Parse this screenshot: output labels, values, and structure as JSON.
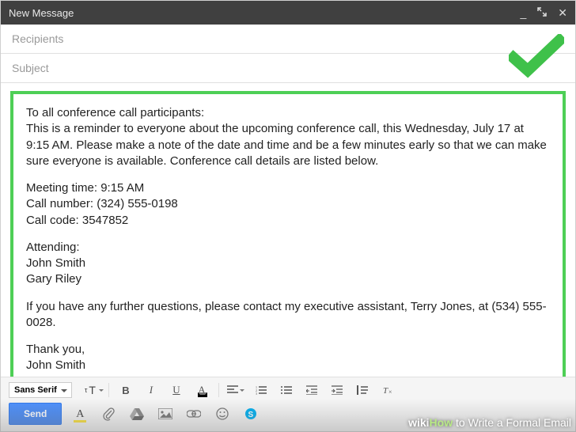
{
  "titlebar": {
    "title": "New Message"
  },
  "fields": {
    "recipients_placeholder": "Recipients",
    "subject_placeholder": "Subject"
  },
  "body": {
    "p1": "To all conference call participants:\nThis is a reminder to everyone about the upcoming conference call, this Wednesday, July 17 at 9:15 AM. Please make a note of the date and time and be a few minutes early so that we can make sure everyone is available. Conference call details are listed below.",
    "p2": "Meeting time: 9:15 AM\nCall number: (324) 555-0198\nCall code: 3547852",
    "p3": "Attending:\nJohn Smith\nGary Riley",
    "p4": "If you have any further questions, please contact my executive assistant, Terry Jones, at (534) 555-0028.",
    "p5": "Thank you,\nJohn Smith"
  },
  "toolbar": {
    "font_family": "Sans Serif",
    "size_icon": "τT",
    "bold": "B",
    "italic": "I",
    "underline": "U",
    "text_color": "A",
    "send_label": "Send",
    "highlight_A": "A"
  },
  "watermark": {
    "wiki": "wiki",
    "how": "How",
    "rest": " to Write a Formal Email"
  },
  "colors": {
    "frame_green": "#4ecf56",
    "send_blue": "#4d90fe"
  }
}
